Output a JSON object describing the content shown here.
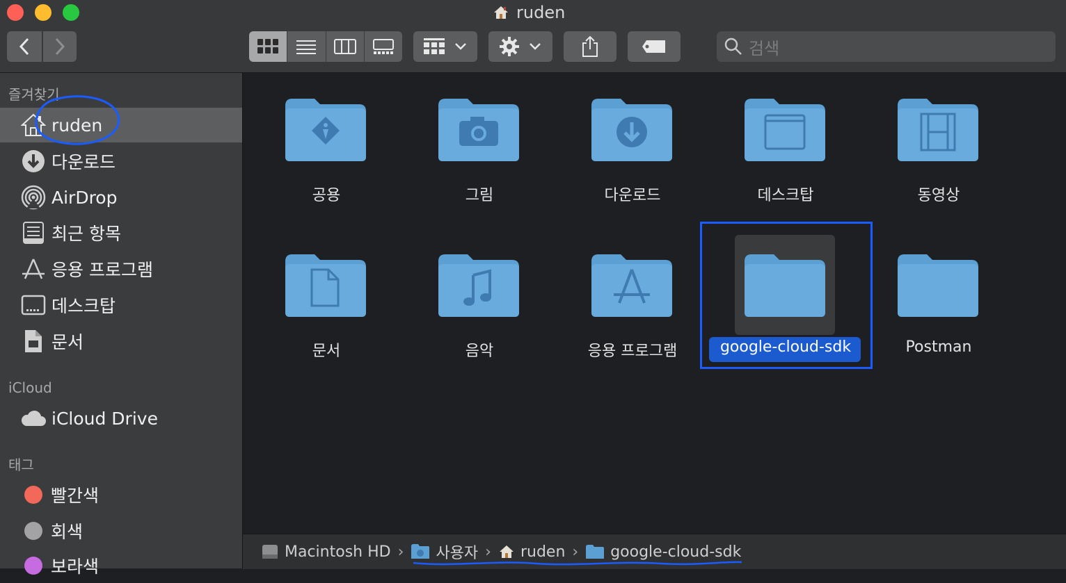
{
  "window": {
    "title": "ruden",
    "title_icon": "home-icon",
    "traffic_lights": [
      "#fe5f57",
      "#febc2e",
      "#28c840"
    ]
  },
  "toolbar": {
    "search_placeholder": "검색"
  },
  "sidebar": {
    "favorites_header": "즐겨찾기",
    "favorites": [
      {
        "label": "ruden",
        "icon": "home-icon",
        "selected": true
      },
      {
        "label": "다운로드",
        "icon": "download-icon"
      },
      {
        "label": "AirDrop",
        "icon": "airdrop-icon"
      },
      {
        "label": "최근 항목",
        "icon": "recents-icon"
      },
      {
        "label": "응용 프로그램",
        "icon": "applications-icon"
      },
      {
        "label": "데스크탑",
        "icon": "desktop-icon"
      },
      {
        "label": "문서",
        "icon": "document-icon"
      }
    ],
    "icloud_header": "iCloud",
    "icloud": [
      {
        "label": "iCloud Drive",
        "icon": "cloud-icon"
      }
    ],
    "tags_header": "태그",
    "tags": [
      {
        "label": "빨간색",
        "color": "#f2685b"
      },
      {
        "label": "회색",
        "color": "#a3a3a6"
      },
      {
        "label": "보라색",
        "color": "#c66be0"
      }
    ]
  },
  "folders": [
    {
      "label": "공용",
      "glyph": "public-icon"
    },
    {
      "label": "그림",
      "glyph": "camera-icon"
    },
    {
      "label": "다운로드",
      "glyph": "download-icon"
    },
    {
      "label": "데스크탑",
      "glyph": "desktop-icon"
    },
    {
      "label": "동영상",
      "glyph": "film-icon"
    },
    {
      "label": "문서",
      "glyph": "document-icon"
    },
    {
      "label": "음악",
      "glyph": "music-icon"
    },
    {
      "label": "응용 프로그램",
      "glyph": "applications-icon"
    },
    {
      "label": "google-cloud-sdk",
      "glyph": "",
      "selected": true
    },
    {
      "label": "Postman",
      "glyph": ""
    }
  ],
  "pathbar": [
    {
      "label": "Macintosh HD",
      "icon": "hard-drive-icon"
    },
    {
      "label": "사용자",
      "icon": "users-folder-icon"
    },
    {
      "label": "ruden",
      "icon": "home-icon"
    },
    {
      "label": "google-cloud-sdk",
      "icon": "folder-icon"
    }
  ],
  "colors": {
    "accent": "#1b5bcf",
    "annotation": "#1a5cff",
    "folder": "#5b9fd3"
  }
}
